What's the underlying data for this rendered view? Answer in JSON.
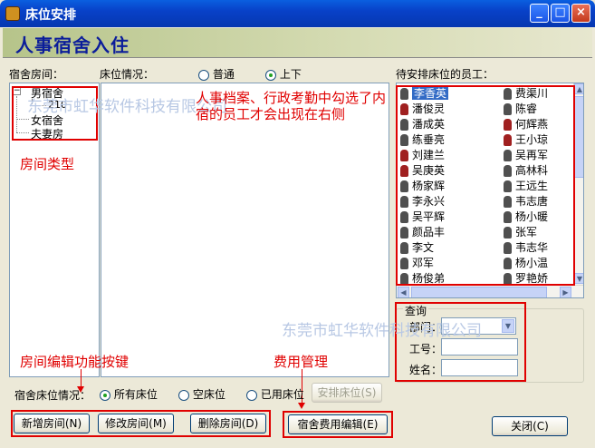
{
  "window": {
    "title": "床位安排",
    "minimize": "_",
    "maximize": "□",
    "close": "×"
  },
  "banner": {
    "title": "人事宿舍入住"
  },
  "dorm": {
    "label": "宿舍房间：",
    "tree": {
      "male": "男宿舍",
      "room": "210",
      "female": "女宿舍",
      "couple": "夫妻房"
    }
  },
  "bed_status": {
    "label": "床位情况：",
    "options": [
      "普通",
      "上下"
    ],
    "selected": "上下"
  },
  "pending": {
    "label": "待安排床位的员工：",
    "employees": [
      {
        "name": "李香英",
        "gender": "m",
        "selected": true
      },
      {
        "name": "费渠川",
        "gender": "m"
      },
      {
        "name": "潘俊灵",
        "gender": "f"
      },
      {
        "name": "陈睿",
        "gender": "m"
      },
      {
        "name": "潘成英",
        "gender": "m"
      },
      {
        "name": "何辉燕",
        "gender": "f"
      },
      {
        "name": "练垂亮",
        "gender": "m"
      },
      {
        "name": "王小琼",
        "gender": "f"
      },
      {
        "name": "刘建兰",
        "gender": "f"
      },
      {
        "name": "吴再军",
        "gender": "m"
      },
      {
        "name": "吴庚英",
        "gender": "f"
      },
      {
        "name": "高林科",
        "gender": "m"
      },
      {
        "name": "杨家辉",
        "gender": "m"
      },
      {
        "name": "王远生",
        "gender": "m"
      },
      {
        "name": "李永兴",
        "gender": "m"
      },
      {
        "name": "韦志唐",
        "gender": "m"
      },
      {
        "name": "吴平辉",
        "gender": "m"
      },
      {
        "name": "杨小暖",
        "gender": "m"
      },
      {
        "name": "颜品丰",
        "gender": "m"
      },
      {
        "name": "张军",
        "gender": "m"
      },
      {
        "name": "李文",
        "gender": "m"
      },
      {
        "name": "韦志华",
        "gender": "m"
      },
      {
        "name": "邓军",
        "gender": "m"
      },
      {
        "name": "杨小温",
        "gender": "m"
      },
      {
        "name": "杨俊弟",
        "gender": "m"
      },
      {
        "name": "罗艳娇",
        "gender": "m"
      }
    ]
  },
  "query": {
    "title": "查询",
    "dept_label": "部门：",
    "jobno_label": "工号：",
    "name_label": "姓名：",
    "dept_value": "",
    "jobno_value": "",
    "name_value": ""
  },
  "annotations": {
    "note": "人事档案、行政考勤中勾选了内宿的员工才会出现在右侧",
    "room_type": "房间类型",
    "room_edit": "房间编辑功能按键",
    "fee_mgmt": "费用管理"
  },
  "watermarks": [
    "东莞市虹华软件科技有限公司",
    "东莞市虹华软件科技有限公司"
  ],
  "bed_filter": {
    "label": "宿舍床位情况：",
    "options": [
      "所有床位",
      "空床位",
      "已用床位"
    ],
    "selected": "所有床位",
    "arrange_button": "安排床位(S)"
  },
  "buttons": {
    "add_room": "新增房间(N)",
    "edit_room": "修改房间(M)",
    "delete_room": "删除房间(D)",
    "fee_edit": "宿舍费用编辑(E)",
    "close": "关闭(C)"
  },
  "icons": {
    "scroll_up": "▲",
    "scroll_down": "▼",
    "scroll_left": "◀",
    "scroll_right": "▶",
    "dropdown": "▼",
    "tree_minus": "−"
  },
  "colors": {
    "annotation": "#e00000",
    "titlebar": "#0841c8",
    "banner_text": "#0b1d9a"
  }
}
